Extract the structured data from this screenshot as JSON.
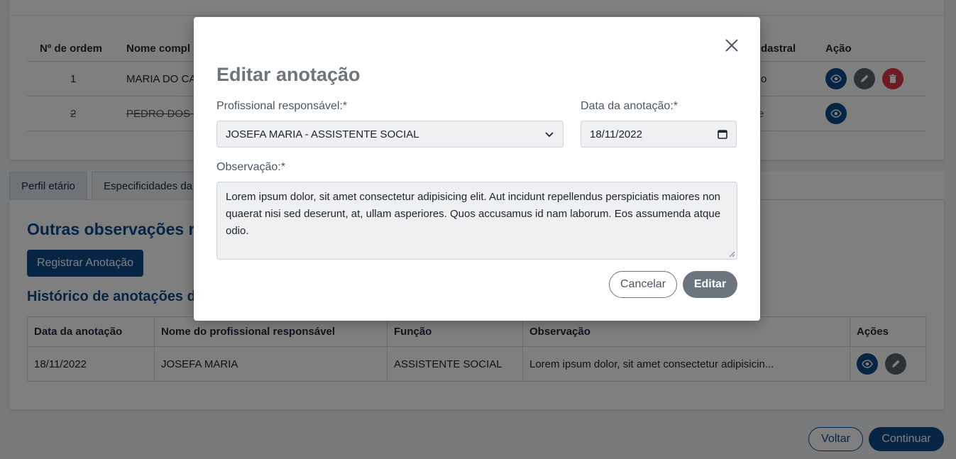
{
  "top_table": {
    "headers": {
      "order": "Nº de ordem",
      "name": "Nome compl",
      "status": "dastral",
      "action": "Ação"
    },
    "rows": [
      {
        "order": "1",
        "name": "MARIA DO CA",
        "status": "o"
      },
      {
        "order": "2",
        "name": "PEDRO DOS S",
        "status": "e"
      }
    ]
  },
  "tabs": [
    "Perfil etário",
    "Especificidades da"
  ],
  "section": {
    "title": "Outras observações r",
    "register_button": "Registrar Anotação",
    "history_title": "Histórico de anotações da"
  },
  "history_table": {
    "headers": [
      "Data da anotação",
      "Nome do profissional responsável",
      "Função",
      "Observação",
      "Ações"
    ],
    "rows": [
      [
        "18/11/2022",
        "JOSEFA MARIA",
        "ASSISTENTE SOCIAL",
        "Lorem ipsum dolor, sit amet consectetur adipisicin..."
      ]
    ]
  },
  "footer": {
    "back": "Voltar",
    "continue": "Continuar"
  },
  "modal": {
    "title": "Editar anotação",
    "professional_label": "Profissional responsável:*",
    "professional_value": "JOSEFA MARIA - ASSISTENTE SOCIAL",
    "date_label": "Data da anotação:*",
    "date_value": "18/11/2022",
    "observation_label": "Observação:*",
    "observation_value": "Lorem ipsum dolor, sit amet consectetur adipisicing elit. Aut incidunt repellendus perspiciatis maiores non quaerat nisi sed deserunt, at, ullam asperiores. Quos accusamus id nam laborum. Eos assumenda atque odio.",
    "cancel": "Cancelar",
    "edit": "Editar"
  },
  "colors": {
    "primary": "#0d4a8a",
    "danger": "#dc3545",
    "secondary": "#6c757d"
  }
}
